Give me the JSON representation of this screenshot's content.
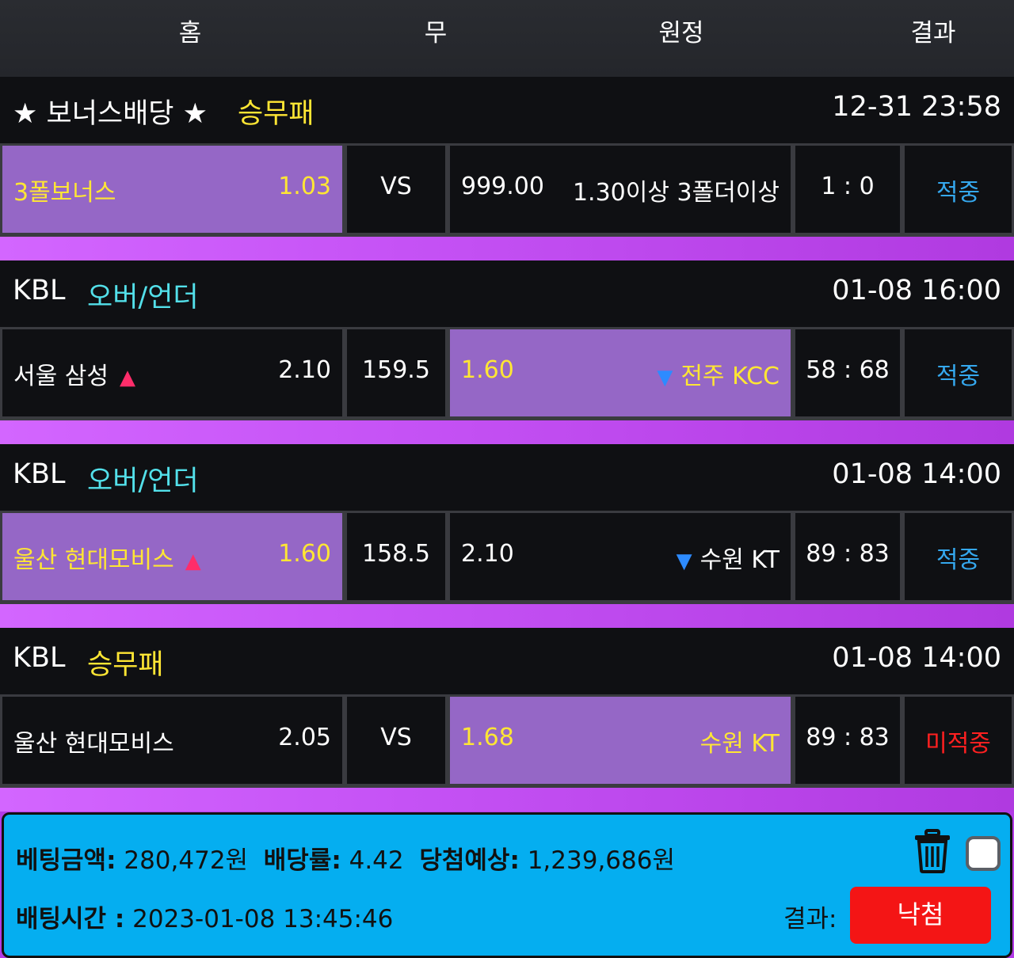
{
  "header": {
    "home": "홈",
    "draw": "무",
    "away": "원정",
    "result": "결과"
  },
  "bets": [
    {
      "league": "★ 보너스배당 ★",
      "market": "승무패",
      "market_color": "yellow",
      "time": "12-31 23:58",
      "home_name": "3폴보너스",
      "home_odds": "1.03",
      "home_arrow": "",
      "middle": "VS",
      "away_odds": "999.00",
      "away_name": "1.30이상 3폴더이상",
      "away_arrow": "",
      "score": "1 : 0",
      "result": "적중",
      "result_type": "win",
      "selected": "home"
    },
    {
      "league": "KBL",
      "market": "오버/언더",
      "market_color": "cyan",
      "time": "01-08 16:00",
      "home_name": "서울 삼성",
      "home_odds": "2.10",
      "home_arrow": "▲",
      "middle": "159.5",
      "away_odds": "1.60",
      "away_name": "전주 KCC",
      "away_arrow": "▼",
      "score": "58 : 68",
      "result": "적중",
      "result_type": "win",
      "selected": "away"
    },
    {
      "league": "KBL",
      "market": "오버/언더",
      "market_color": "cyan",
      "time": "01-08 14:00",
      "home_name": "울산 현대모비스",
      "home_odds": "1.60",
      "home_arrow": "▲",
      "middle": "158.5",
      "away_odds": "2.10",
      "away_name": "수원 KT",
      "away_arrow": "▼",
      "score": "89 : 83",
      "result": "적중",
      "result_type": "win",
      "selected": "home"
    },
    {
      "league": "KBL",
      "market": "승무패",
      "market_color": "yellow",
      "time": "01-08 14:00",
      "home_name": "울산 현대모비스",
      "home_odds": "2.05",
      "home_arrow": "",
      "middle": "VS",
      "away_odds": "1.68",
      "away_name": "수원 KT",
      "away_arrow": "",
      "score": "89 : 83",
      "result": "미적중",
      "result_type": "lose",
      "selected": "away"
    }
  ],
  "footer": {
    "amount_label": "베팅금액:",
    "amount": "280,472원",
    "rate_label": "배당률:",
    "rate": "4.42",
    "expected_label": "당첨예상:",
    "expected": "1,239,686원",
    "time_label": "배팅시간 :",
    "time": "2023-01-08 13:45:46",
    "result_label": "결과:",
    "result_button": "낙첨",
    "icons": {
      "delete": "trash-icon",
      "select": "checkbox"
    }
  },
  "colors": {
    "selected_cell": "#9567c6",
    "cell_bg": "#0f1013",
    "footer_bg": "#05aef0",
    "stripe": "#c552f5",
    "yellow_text": "#ffe634",
    "cyan_text": "#53e0ea",
    "win_text": "#35a8ee",
    "lose_text": "#ff2020",
    "button_red": "#f41515"
  }
}
